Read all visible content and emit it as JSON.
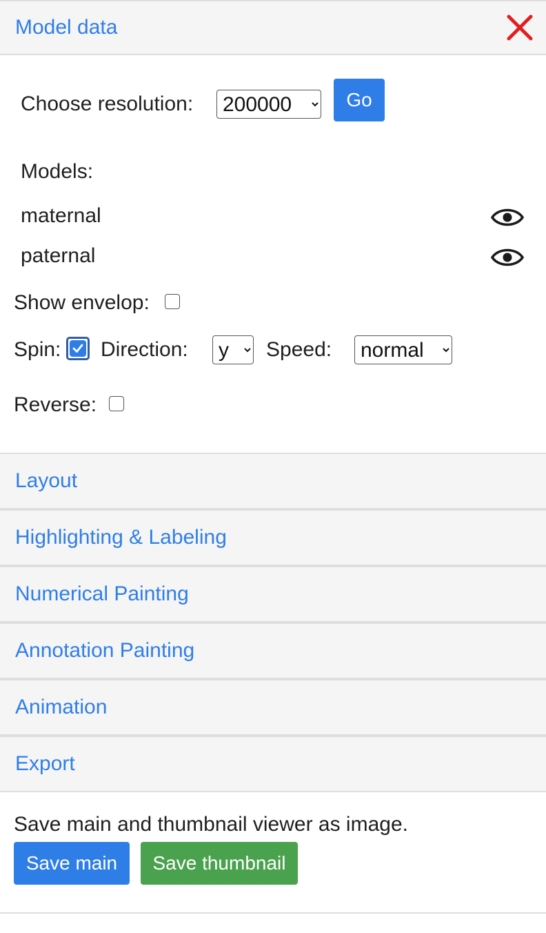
{
  "model_data": {
    "title": "Model data",
    "close_icon": "close-icon",
    "close_color": "#e02020",
    "resolution_label": "Choose resolution:",
    "resolution_value": "200000",
    "go_label": "Go",
    "models_label": "Models:",
    "models": [
      {
        "name": "maternal",
        "icon": "eye-icon"
      },
      {
        "name": "paternal",
        "icon": "eye-icon"
      }
    ],
    "show_envelop_label": "Show envelop:",
    "show_envelop_checked": false,
    "spin_label": "Spin:",
    "spin_checked": true,
    "direction_label": "Direction:",
    "direction_value": "y",
    "speed_label": "Speed:",
    "speed_value": "normal",
    "reverse_label": "Reverse:",
    "reverse_checked": false
  },
  "sections": [
    {
      "label": "Layout"
    },
    {
      "label": "Highlighting & Labeling"
    },
    {
      "label": "Numerical Painting"
    },
    {
      "label": "Annotation Painting"
    },
    {
      "label": "Animation"
    },
    {
      "label": "Export"
    }
  ],
  "export": {
    "description": "Save main and thumbnail viewer as image.",
    "save_main_label": "Save main",
    "save_thumbnail_label": "Save thumbnail"
  },
  "colors": {
    "accent": "#2f7ee8",
    "success": "#4aa24e",
    "header_bg": "#f5f5f5"
  }
}
